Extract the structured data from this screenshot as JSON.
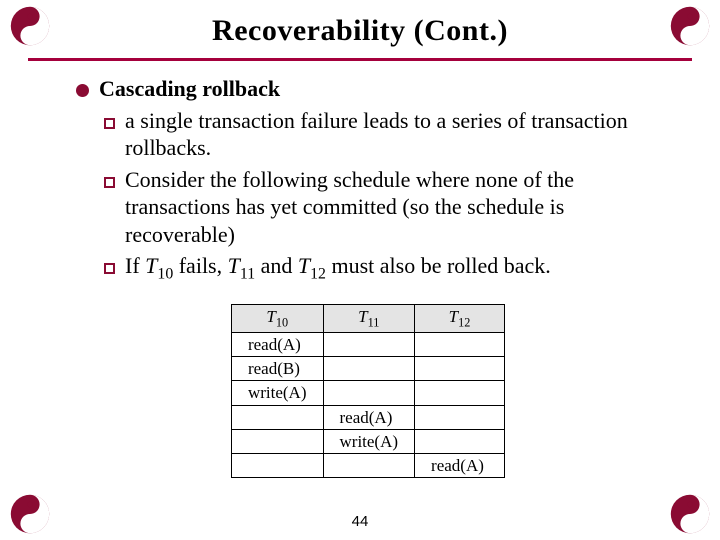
{
  "title": "Recoverability (Cont.)",
  "page_number": "44",
  "corner_icon": "yin-yang-icon",
  "accent_color": "#a5003c",
  "content": {
    "heading": "Cascading rollback",
    "points": [
      "a single transaction failure leads to a series of transaction rollbacks.",
      "Consider the following schedule where none of the transactions has yet committed (so the schedule is recoverable)"
    ],
    "third_point_prefix": "If ",
    "t10": "T",
    "n10": "10",
    "third_mid1": " fails, ",
    "t11": "T",
    "n11": "11",
    "third_mid2": " and ",
    "t12": "T",
    "n12": "12",
    "third_suffix": " must also be rolled back."
  },
  "chart_data": {
    "type": "table",
    "title": "Transaction schedule",
    "columns": [
      "T10",
      "T11",
      "T12"
    ],
    "rows": [
      {
        "T10": "read(A)",
        "T11": "",
        "T12": ""
      },
      {
        "T10": "read(B)",
        "T11": "",
        "T12": ""
      },
      {
        "T10": "write(A)",
        "T11": "",
        "T12": ""
      },
      {
        "T10": "",
        "T11": "read(A)",
        "T12": ""
      },
      {
        "T10": "",
        "T11": "write(A)",
        "T12": ""
      },
      {
        "T10": "",
        "T11": "",
        "T12": "read(A)"
      }
    ]
  },
  "sched": {
    "h1": "T",
    "h1n": "10",
    "h2": "T",
    "h2n": "11",
    "h3": "T",
    "h3n": "12",
    "r1c1": "read(A)",
    "r2c1": "read(B)",
    "r3c1": "write(A)",
    "r4c2": "read(A)",
    "r5c2": "write(A)",
    "r6c3": "read(A)"
  }
}
